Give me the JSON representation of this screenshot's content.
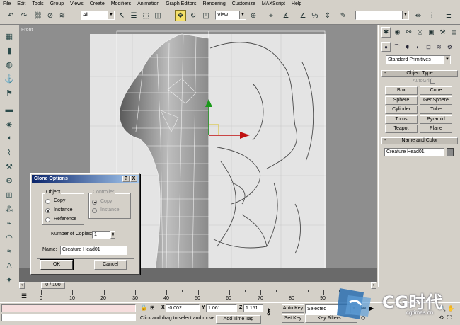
{
  "menu": [
    "File",
    "Edit",
    "Tools",
    "Group",
    "Views",
    "Create",
    "Modifiers",
    "Animation",
    "Graph Editors",
    "Rendering",
    "Customize",
    "MAXScript",
    "Help"
  ],
  "toolbar": {
    "selection_filter": "All",
    "reference_coord": "View",
    "named_selection": ""
  },
  "viewport": {
    "label": "Front"
  },
  "command_panel": {
    "category_dropdown": "Standard Primitives",
    "object_type_title": "Object Type",
    "autogrid_label": "AutoGrid",
    "buttons": [
      "Box",
      "Cone",
      "Sphere",
      "GeoSphere",
      "Cylinder",
      "Tube",
      "Torus",
      "Pyramid",
      "Teapot",
      "Plane"
    ],
    "name_color_title": "Name and Color",
    "object_name": "Creature Head01",
    "object_color": "#8a8a8a"
  },
  "dialog": {
    "title": "Clone Options",
    "object_group": "Object",
    "object_options": [
      "Copy",
      "Instance",
      "Reference"
    ],
    "object_selected": "Instance",
    "controller_group": "Controller",
    "controller_options": [
      "Copy",
      "Instance"
    ],
    "copies_label": "Number of Copies:",
    "copies_value": "1",
    "name_label": "Name:",
    "name_value": "Creature Head01",
    "ok_label": "OK",
    "cancel_label": "Cancel",
    "help_glyph": "?",
    "close_glyph": "X"
  },
  "timeline": {
    "frame_readout": "0 / 100",
    "ticks": [
      "0",
      "10",
      "20",
      "30",
      "40",
      "50",
      "60",
      "70",
      "80",
      "90"
    ]
  },
  "status": {
    "prompt": "Click and drag to select and move",
    "add_time_tag": "Add Time Tag",
    "x_label": "X",
    "x_value": "-0.002",
    "y_label": "Y",
    "y_value": "1.061",
    "z_label": "Z",
    "z_value": "1.151",
    "auto_key": "Auto Key",
    "set_key": "Set Key",
    "key_mode": "Selected",
    "key_filters": "Key Filters..."
  },
  "watermark": {
    "brand": "CG时代",
    "domain": "cgtimes.cn"
  }
}
